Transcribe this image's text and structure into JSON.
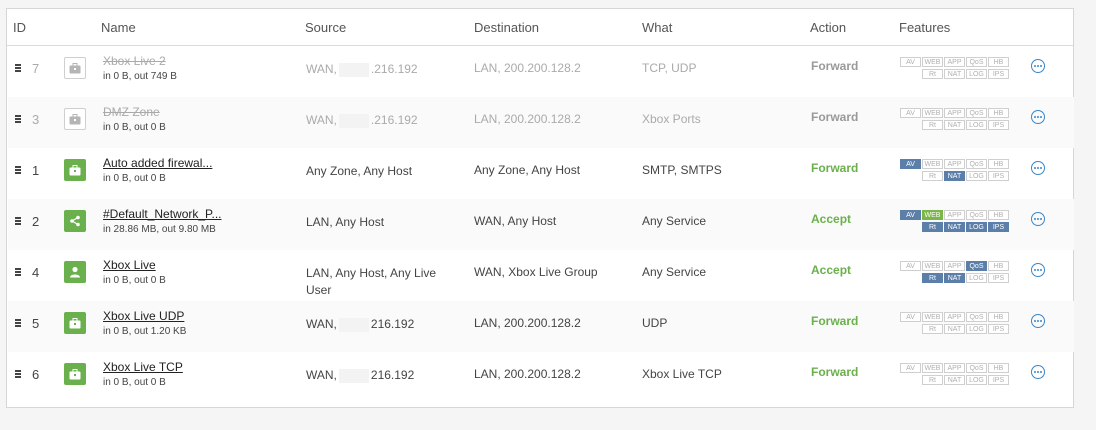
{
  "columns": {
    "id": "ID",
    "name": "Name",
    "source": "Source",
    "destination": "Destination",
    "what": "What",
    "action": "Action",
    "features": "Features"
  },
  "feature_badges_row1": [
    "AV",
    "WEB",
    "APP",
    "QoS",
    "HB"
  ],
  "feature_badges_row2": [
    "Rt",
    "NAT",
    "LOG",
    "IPS"
  ],
  "rows": [
    {
      "id": "7",
      "icon": "briefcase-icon",
      "icon_style": "grey",
      "name": "Xbox Live 2",
      "disabled": true,
      "stats": "in 0 B, out 749 B",
      "source": ".216.192",
      "source_prefix": "WAN,",
      "destination": "LAN, 200.200.128.2",
      "what": "TCP, UDP",
      "action": "Forward",
      "action_color": "grey",
      "features_on": []
    },
    {
      "id": "3",
      "icon": "briefcase-icon",
      "icon_style": "grey",
      "name": "DMZ Zone",
      "disabled": true,
      "stats": "in 0 B, out 0 B",
      "source": ".216.192",
      "source_prefix": "WAN,",
      "destination": "LAN, 200.200.128.2",
      "what": "Xbox Ports",
      "action": "Forward",
      "action_color": "grey",
      "features_on": []
    },
    {
      "id": "1",
      "icon": "briefcase-icon",
      "icon_style": "green",
      "name": "Auto added firewal...",
      "disabled": false,
      "stats": "in 0 B, out 0 B",
      "source": "Any Zone, Any Host",
      "source_prefix": "",
      "destination": "Any Zone, Any Host",
      "what": "SMTP, SMTPS",
      "action": "Forward",
      "action_color": "green",
      "features_on": [
        "AV",
        "NAT"
      ]
    },
    {
      "id": "2",
      "icon": "share-icon",
      "icon_style": "green",
      "name": "#Default_Network_P...",
      "disabled": false,
      "stats": "in 28.86 MB, out 9.80 MB",
      "source": "LAN, Any Host",
      "source_prefix": "",
      "destination": "WAN, Any Host",
      "what": "Any Service",
      "action": "Accept",
      "action_color": "green",
      "features_on": [
        "AV",
        "WEB",
        "Rt",
        "NAT",
        "LOG",
        "IPS"
      ]
    },
    {
      "id": "4",
      "icon": "user-icon",
      "icon_style": "green",
      "name": "Xbox Live",
      "disabled": false,
      "stats": "in 0 B, out 0 B",
      "source": "LAN, Any Host, Any Live User",
      "source_prefix": "",
      "destination": "WAN, Xbox Live Group",
      "what": "Any Service",
      "action": "Accept",
      "action_color": "green",
      "features_on": [
        "QoS",
        "Rt",
        "NAT"
      ]
    },
    {
      "id": "5",
      "icon": "briefcase-icon",
      "icon_style": "green",
      "name": "Xbox Live UDP",
      "disabled": false,
      "stats": "in 0 B, out 1.20 KB",
      "source": "216.192",
      "source_prefix": "WAN,",
      "destination": "LAN, 200.200.128.2",
      "what": "UDP",
      "action": "Forward",
      "action_color": "green",
      "features_on": []
    },
    {
      "id": "6",
      "icon": "briefcase-icon",
      "icon_style": "green",
      "name": "Xbox Live TCP",
      "disabled": false,
      "stats": "in 0 B, out 0 B",
      "source": "216.192",
      "source_prefix": "WAN,",
      "destination": "LAN, 200.200.128.2",
      "what": "Xbox Live TCP",
      "action": "Forward",
      "action_color": "green",
      "features_on": []
    }
  ],
  "colors": {
    "accent_green": "#6ab04c",
    "badge_blue": "#5b7fa8",
    "badge_green": "#7ab648",
    "more_blue": "#3a86c8"
  }
}
